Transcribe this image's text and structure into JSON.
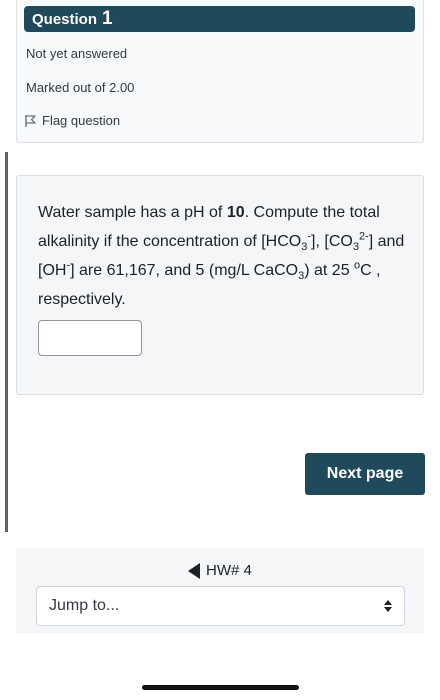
{
  "question_info": {
    "question_word": "Question",
    "question_number": "1",
    "status": "Not yet answered",
    "marks": "Marked out of 2.00",
    "flag_label": "Flag question"
  },
  "question": {
    "t1": "Water sample has a pH of ",
    "ph_value": "10",
    "t2": ". Compute the total alkalinity if the concentration of [HCO",
    "sub3a": "3",
    "sup_minus_a": "-",
    "t3": "], [CO",
    "sub3b": "3",
    "sup_2minus": "2-",
    "t4": "] and [OH",
    "sup_minus_b": "-",
    "t5": "] are 61,167, and 5   (mg/L CaCO",
    "sub3c": "3",
    "t6": ") at 25 ",
    "sup_o": "o",
    "t7": "C , respectively.",
    "answer_value": ""
  },
  "buttons": {
    "next_page": "Next page"
  },
  "navigation": {
    "prev_activity": "HW# 4",
    "jump_to": "Jump to..."
  },
  "icons": {
    "flag": "flag-icon",
    "prev": "triangle-left-icon",
    "select": "up-down-chevron-icon"
  },
  "colors": {
    "header_bg": "#1e4a5c",
    "button_bg": "#1e4a5c",
    "card_bg": "#f4f6f8"
  }
}
